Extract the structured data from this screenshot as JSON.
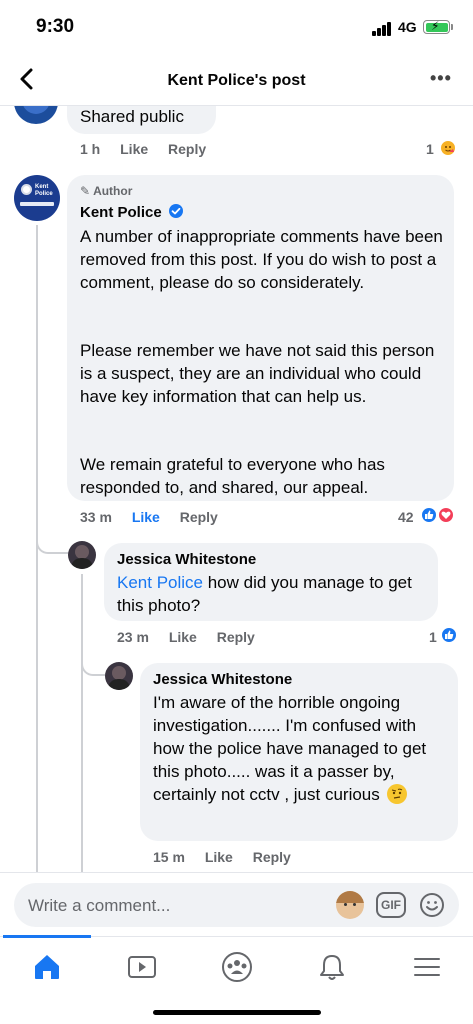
{
  "status": {
    "time": "9:30",
    "network": "4G"
  },
  "nav": {
    "title": "Kent Police's post"
  },
  "prev_comment": {
    "text": "Shared public",
    "time": "1 h",
    "like": "Like",
    "reply": "Reply",
    "reaction_count": "1"
  },
  "main_comment": {
    "badge": "Author",
    "name": "Kent Police",
    "avatar_text_1": "Kent",
    "avatar_text_2": "Police",
    "para1": "A number of inappropriate comments have been removed from this post. If you do wish to post a comment, please do so considerately.",
    "para2": "Please remember we have not said this person is a suspect, they are an individual who could have key information that can help us.",
    "para3": "We remain grateful to everyone who has responded to, and shared, our appeal.",
    "time": "33 m",
    "like": "Like",
    "reply": "Reply",
    "reaction_count": "42"
  },
  "reply1": {
    "name": "Jessica Whitestone",
    "mention": "Kent Police",
    "text": " how did you manage to get this photo?",
    "time": "23 m",
    "like": "Like",
    "reply": "Reply",
    "reaction_count": "1"
  },
  "reply2": {
    "name": "Jessica Whitestone",
    "text": "I'm aware of the horrible ongoing investigation....... I'm confused with how the police have managed to get this photo..... was it a passer by, certainly not cctv , just curious",
    "time": "15 m",
    "like": "Like",
    "reply": "Reply"
  },
  "composer": {
    "placeholder": "Write a comment..."
  },
  "colors": {
    "accent": "#1877f2",
    "bubble": "#f0f2f5",
    "meta": "#65676b",
    "love": "#f33e58"
  }
}
